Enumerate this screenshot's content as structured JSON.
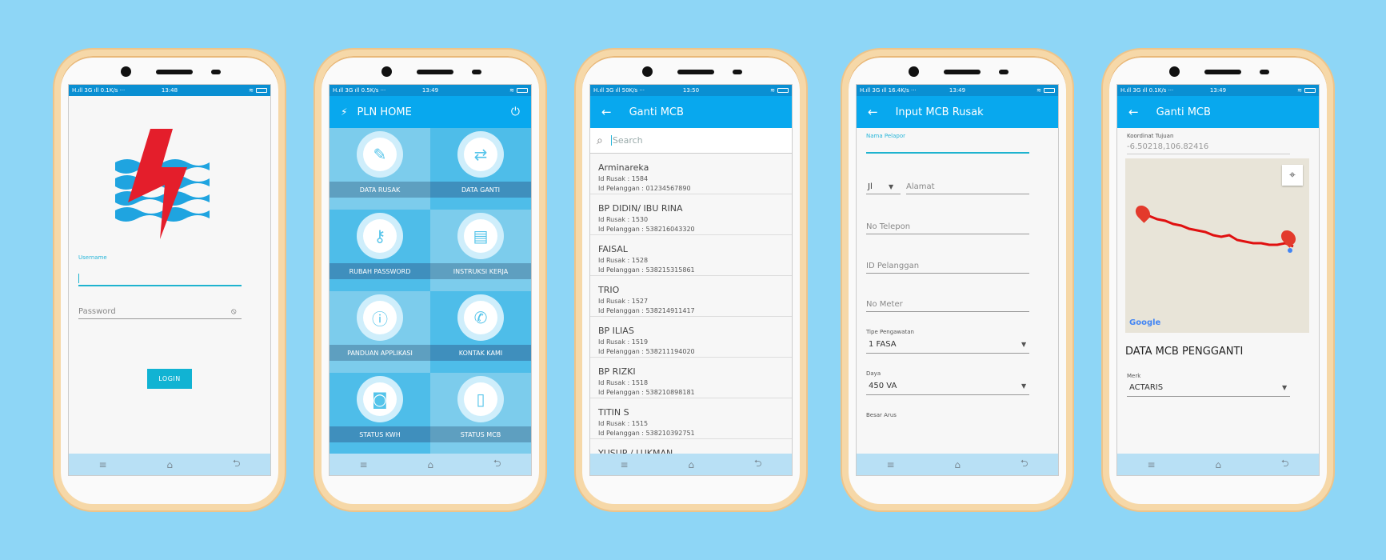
{
  "status_common": {
    "left": "H.ıll 3G ıll",
    "wifi": "≋"
  },
  "phones": [
    {
      "status_speed": "0.1K/s ···",
      "time": "13:48"
    },
    {
      "status_speed": "0.5K/s ···",
      "time": "13:49"
    },
    {
      "status_speed": "50K/s ···",
      "time": "13:50"
    },
    {
      "status_speed": "16.4K/s ···",
      "time": "13:49"
    },
    {
      "status_speed": "0.1K/s ···",
      "time": "13:49"
    }
  ],
  "login": {
    "username_label": "Username",
    "password_placeholder": "Password",
    "login_button": "LOGIN"
  },
  "home": {
    "title": "PLN HOME",
    "tiles": [
      {
        "label": "DATA RUSAK",
        "icon": "pencil-icon"
      },
      {
        "label": "DATA GANTI",
        "icon": "swap-icon"
      },
      {
        "label": "RUBAH PASSWORD",
        "icon": "key-icon"
      },
      {
        "label": "INSTRUKSI KERJA",
        "icon": "book-icon"
      },
      {
        "label": "PANDUAN APPLIKASI",
        "icon": "info-icon"
      },
      {
        "label": "KONTAK KAMI",
        "icon": "phone-icon"
      },
      {
        "label": "STATUS KWH",
        "icon": "meter-icon"
      },
      {
        "label": "STATUS MCB",
        "icon": "mcb-icon"
      }
    ]
  },
  "ganti_list": {
    "title": "Ganti MCB",
    "search_placeholder": "Search",
    "items": [
      {
        "name": "Arminareka",
        "rusak": "Id Rusak : 1584",
        "pel": "Id Pelanggan : 01234567890"
      },
      {
        "name": "BP DIDIN/ IBU RINA",
        "rusak": "Id Rusak : 1530",
        "pel": "Id Pelanggan : 538216043320"
      },
      {
        "name": "FAISAL",
        "rusak": "Id Rusak : 1528",
        "pel": "Id Pelanggan : 538215315861"
      },
      {
        "name": "TRIO",
        "rusak": "Id Rusak : 1527",
        "pel": "Id Pelanggan : 538214911417"
      },
      {
        "name": "BP ILIAS",
        "rusak": "Id Rusak : 1519",
        "pel": "Id Pelanggan : 538211194020"
      },
      {
        "name": "BP RIZKI",
        "rusak": "Id Rusak : 1518",
        "pel": "Id Pelanggan : 538210898181"
      },
      {
        "name": "TITIN S",
        "rusak": "Id Rusak : 1515",
        "pel": "Id Pelanggan : 538210392751"
      },
      {
        "name": "YUSUP / LUKMAN",
        "rusak": "",
        "pel": ""
      }
    ]
  },
  "input_form": {
    "title": "Input MCB Rusak",
    "nama_pelapor_label": "Nama Pelapor",
    "jl_value": "Jl",
    "alamat_placeholder": "Alamat",
    "telepon_placeholder": "No Telepon",
    "id_pelanggan_placeholder": "ID Pelanggan",
    "no_meter_placeholder": "No Meter",
    "tipe_label": "Tipe Pengawatan",
    "tipe_value": "1 FASA",
    "daya_label": "Daya",
    "daya_value": "450 VA",
    "besar_arus_label": "Besar Arus"
  },
  "ganti_map": {
    "title": "Ganti MCB",
    "koordinat_label": "Koordinat Tujuan",
    "koordinat_value": "-6.50218,106.82416",
    "google_logo": "Google",
    "section_title": "DATA MCB PENGGANTI",
    "merk_label": "Merk",
    "merk_value": "ACTARIS"
  },
  "nav_icons": [
    "≡",
    "⌂",
    "⮌"
  ]
}
